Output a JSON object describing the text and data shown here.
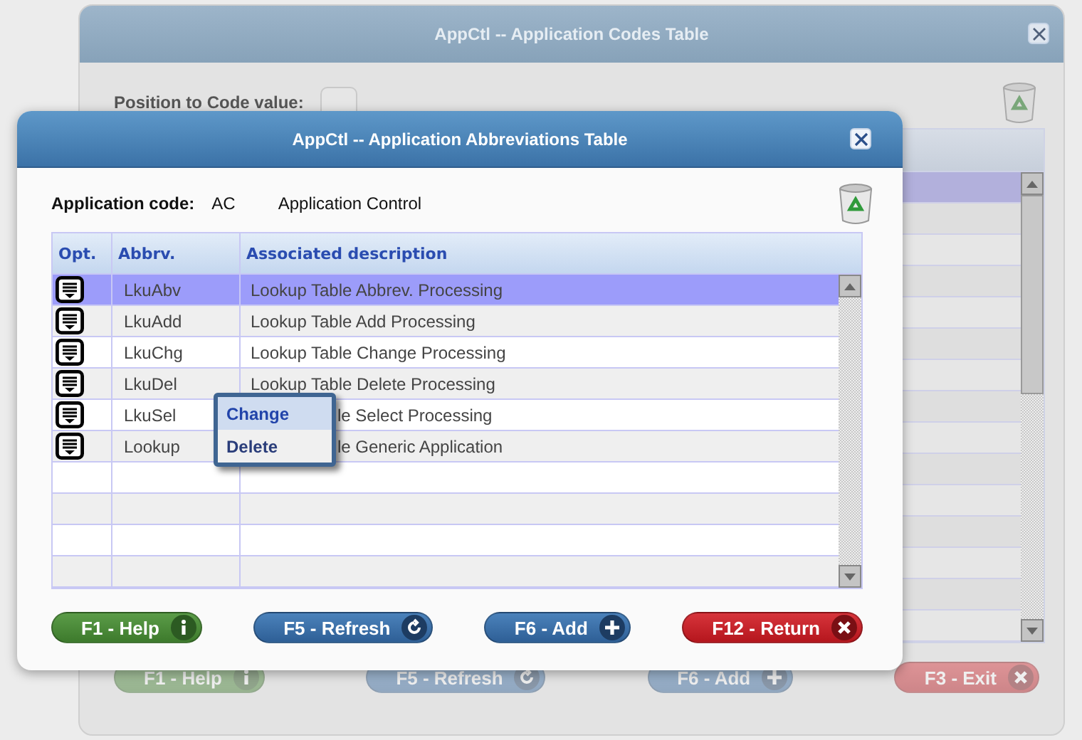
{
  "background_window": {
    "title": "AppCtl -- Application Codes Table",
    "position_label": "Position to Code value:",
    "rows": [
      {
        "selected": true
      },
      {
        "selected": false
      },
      {
        "selected": false
      },
      {
        "selected": false
      },
      {
        "selected": false
      },
      {
        "selected": false
      },
      {
        "selected": false
      },
      {
        "selected": false
      },
      {
        "selected": false
      },
      {
        "selected": false
      },
      {
        "selected": false
      },
      {
        "selected": false
      },
      {
        "selected": false
      },
      {
        "selected": false
      },
      {
        "selected": false
      }
    ],
    "buttons": [
      {
        "label": "F1 - Help",
        "kind": "help"
      },
      {
        "label": "F5 - Refresh",
        "kind": "refresh"
      },
      {
        "label": "F6 - Add",
        "kind": "add"
      },
      {
        "label": "F3 - Exit",
        "kind": "exit"
      }
    ]
  },
  "dialog": {
    "title": "AppCtl -- Application Abbreviations Table",
    "code_label": "Application code:",
    "code": "AC",
    "code_name": "Application Control",
    "columns": [
      "Opt.",
      "Abbrv.",
      "Associated description"
    ],
    "rows": [
      {
        "abbrv": "LkuAbv",
        "description": "Lookup Table Abbrev. Processing",
        "selected": true,
        "menu_open": false
      },
      {
        "abbrv": "LkuAdd",
        "description": "Lookup Table Add Processing",
        "selected": false,
        "menu_open": false
      },
      {
        "abbrv": "LkuChg",
        "description": "Lookup Table Change Processing",
        "selected": false,
        "menu_open": false
      },
      {
        "abbrv": "LkuDel",
        "description": "Lookup Table Delete Processing",
        "selected": false,
        "menu_open": true
      },
      {
        "abbrv": "LkuSel",
        "description": "le Select Processing",
        "selected": false,
        "menu_open": false
      },
      {
        "abbrv": "Lookup",
        "description": "le Generic Application",
        "selected": false,
        "menu_open": false
      },
      {
        "selected": false
      },
      {
        "selected": false
      },
      {
        "selected": false
      },
      {
        "selected": false
      }
    ],
    "context_menu": [
      {
        "label": "Change",
        "selected": true
      },
      {
        "label": "Delete",
        "selected": false
      }
    ],
    "buttons": [
      {
        "label": "F1 - Help",
        "kind": "help"
      },
      {
        "label": "F5 - Refresh",
        "kind": "refresh"
      },
      {
        "label": "F6 - Add",
        "kind": "add"
      },
      {
        "label": "F12 - Return",
        "kind": "return"
      }
    ]
  }
}
